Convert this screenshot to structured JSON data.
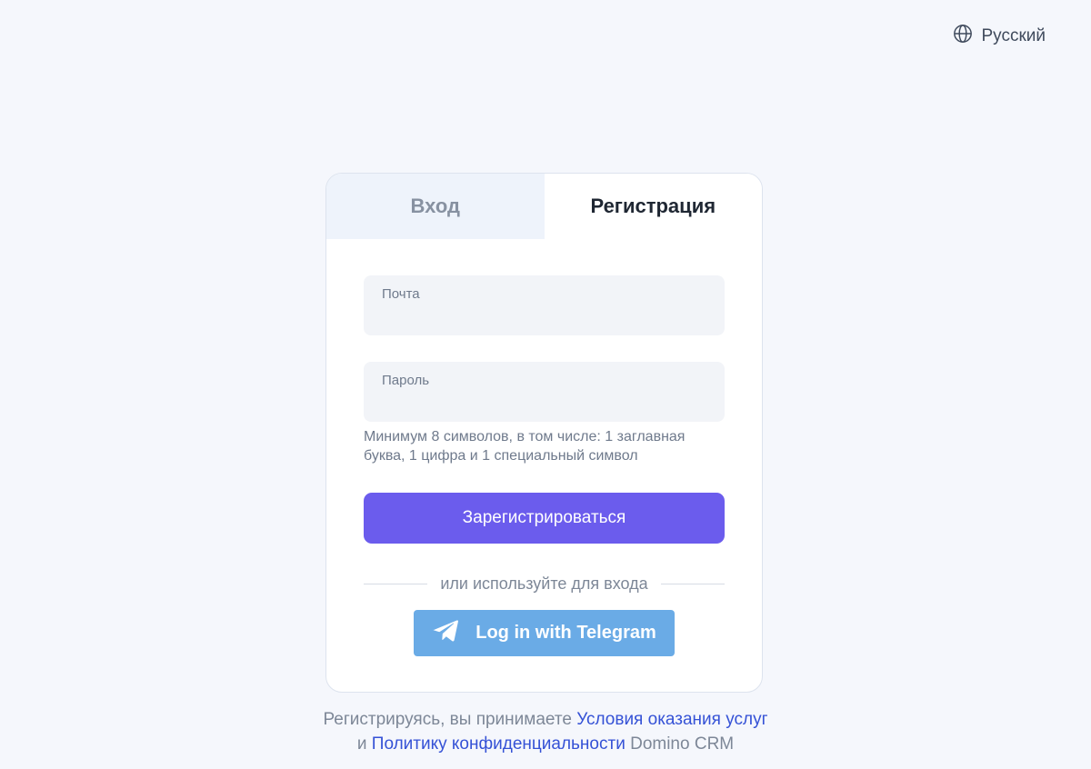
{
  "language": {
    "label": "Русский",
    "icon": "globe-icon"
  },
  "tabs": [
    {
      "label": "Вход",
      "active": false
    },
    {
      "label": "Регистрация",
      "active": true
    }
  ],
  "form": {
    "email": {
      "label": "Почта",
      "value": ""
    },
    "password": {
      "label": "Пароль",
      "value": ""
    },
    "password_hint": "Минимум 8 символов, в том числе: 1 заглавная буква, 1 цифра и 1 специальный символ",
    "submit_label": "Зарегистрироваться",
    "divider_text": "или используйте для входа",
    "telegram_label": "Log in with Telegram",
    "telegram_icon": "telegram-icon"
  },
  "terms": {
    "prefix": "Регистрируясь, вы принимаете",
    "terms_link": "Условия оказания услуг",
    "and": "и",
    "privacy_link": "Политику конфиденциальности",
    "suffix": "Domino CRM"
  },
  "colors": {
    "background": "#f5f7fc",
    "primary_button": "#6b5ced",
    "telegram_button": "#6aabe6",
    "link": "#3552d6"
  }
}
